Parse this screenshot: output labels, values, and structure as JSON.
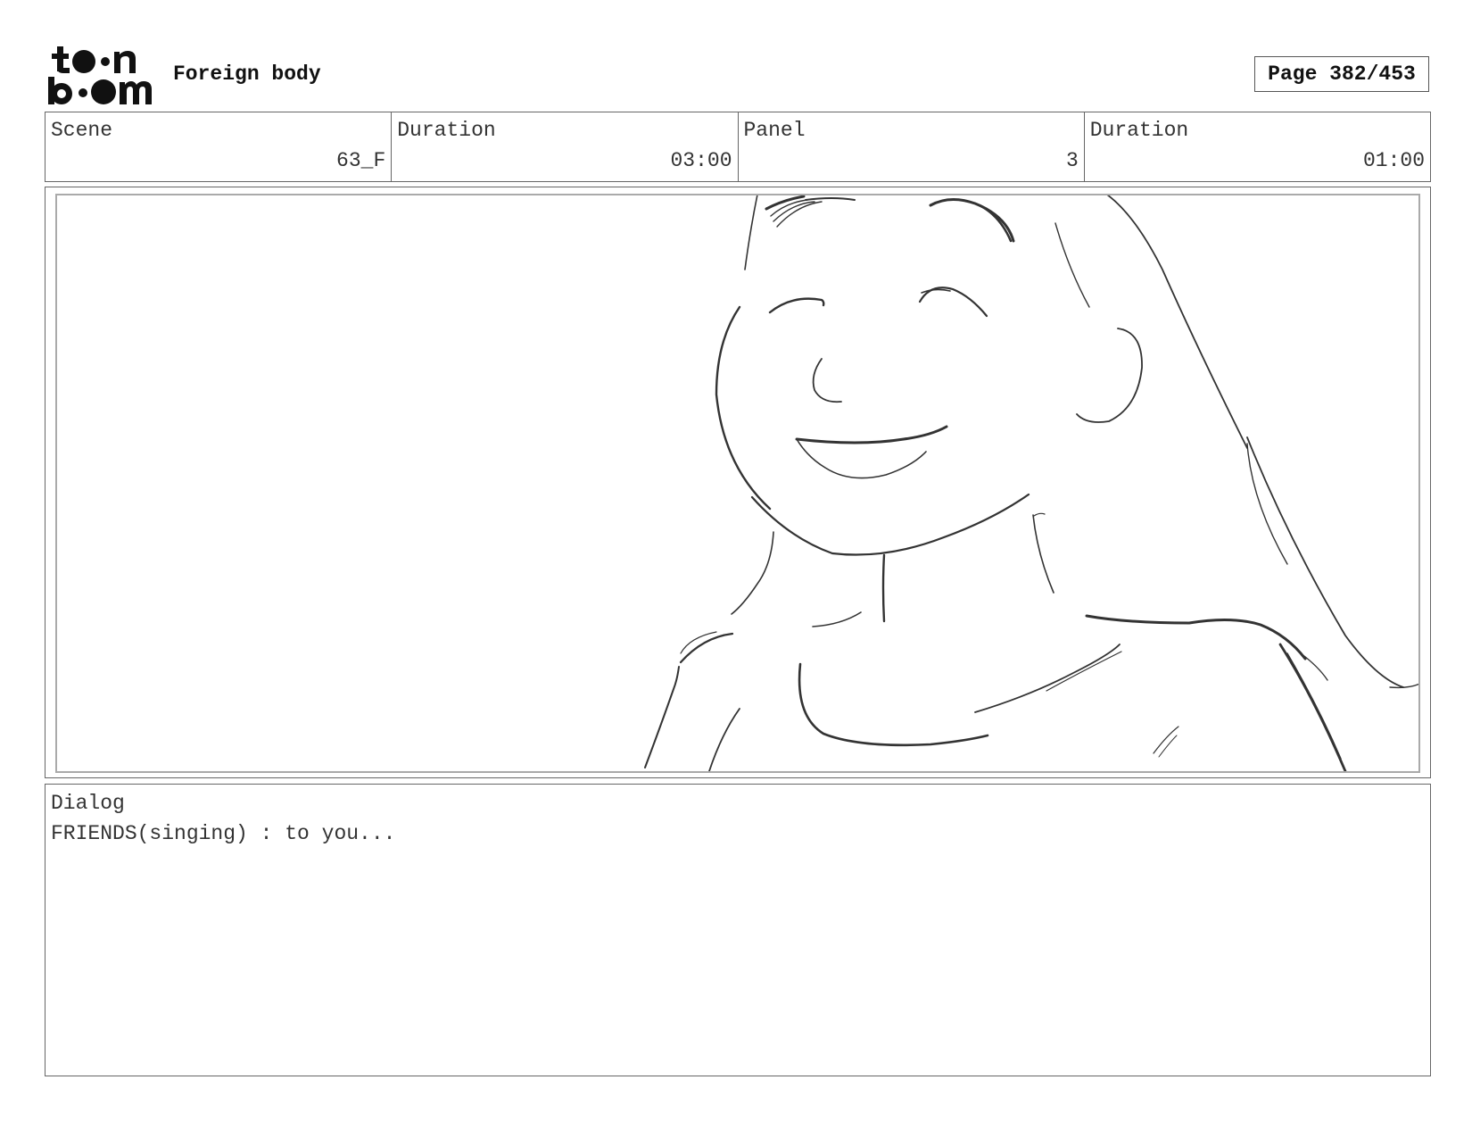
{
  "header": {
    "logo_text": "toon boom",
    "project_title": "Foreign body",
    "page_label": "Page 382/453"
  },
  "info": [
    {
      "label": "Scene",
      "value": "63_F"
    },
    {
      "label": "Duration",
      "value": "03:00"
    },
    {
      "label": "Panel",
      "value": "3"
    },
    {
      "label": "Duration",
      "value": "01:00"
    }
  ],
  "panel": {
    "image": "pencil-sketch-smiling-girl-long-hair"
  },
  "dialog": {
    "label": "Dialog",
    "text": "FRIENDS(singing) : to you..."
  }
}
